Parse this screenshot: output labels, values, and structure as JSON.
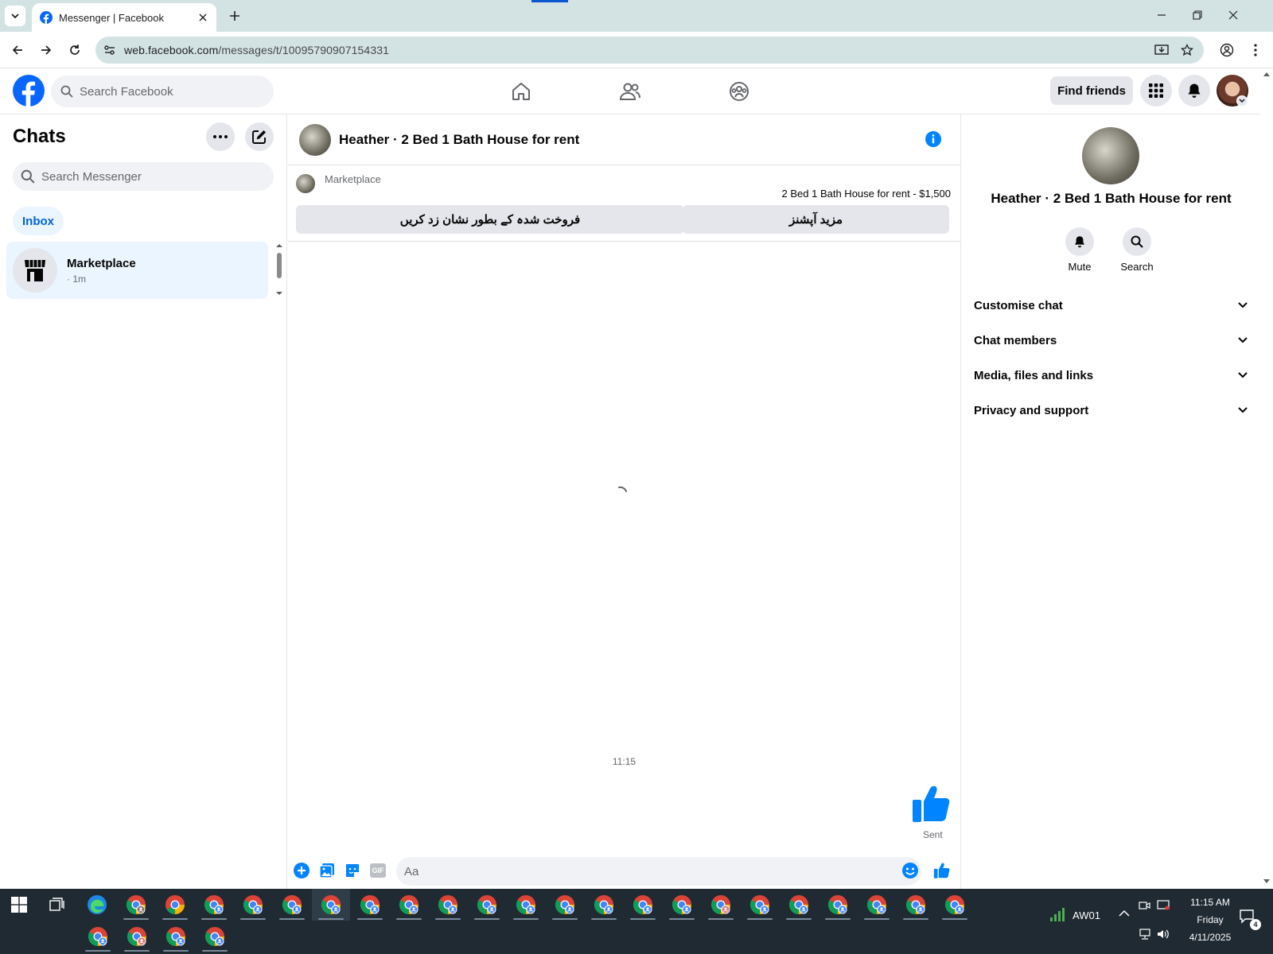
{
  "browser": {
    "tab_title": "Messenger | Facebook",
    "url_host": "web.facebook.com",
    "url_path": "/messages/t/10095790907154331"
  },
  "fb_header": {
    "search_placeholder": "Search Facebook",
    "find_friends_label": "Find friends"
  },
  "chats_panel": {
    "title": "Chats",
    "search_placeholder": "Search Messenger",
    "inbox_tab": "Inbox",
    "items": [
      {
        "name": "Marketplace",
        "time": "· 1m"
      }
    ]
  },
  "conversation": {
    "header_title": "Heather · 2 Bed 1 Bath House for rent",
    "marketplace_label": "Marketplace",
    "listing_text": "2 Bed 1 Bath House for rent - $1,500",
    "mark_sold_button": "فروخت شدہ کے بطور نشان زد کریں",
    "more_options_button": "مزید آپشنز",
    "timestamp": "11:15",
    "sent_label": "Sent",
    "message_placeholder": "Aa",
    "gif_label": "GIF"
  },
  "info_panel": {
    "name": "Heather · 2 Bed 1 Bath House for rent",
    "actions": [
      {
        "label": "Mute",
        "icon": "bell-icon"
      },
      {
        "label": "Search",
        "icon": "search-icon"
      }
    ],
    "sections": [
      "Customise chat",
      "Chat members",
      "Media, files and links",
      "Privacy and support"
    ]
  },
  "taskbar": {
    "network_name": "AW01",
    "time": "11:15 AM",
    "day": "Friday",
    "date": "4/11/2025",
    "notification_count": "4"
  },
  "colors": {
    "facebook_blue": "#0866ff",
    "messenger_blue": "#0084ff",
    "browser_frame": "#d3e3e4",
    "taskbar": "#1f2a33"
  }
}
